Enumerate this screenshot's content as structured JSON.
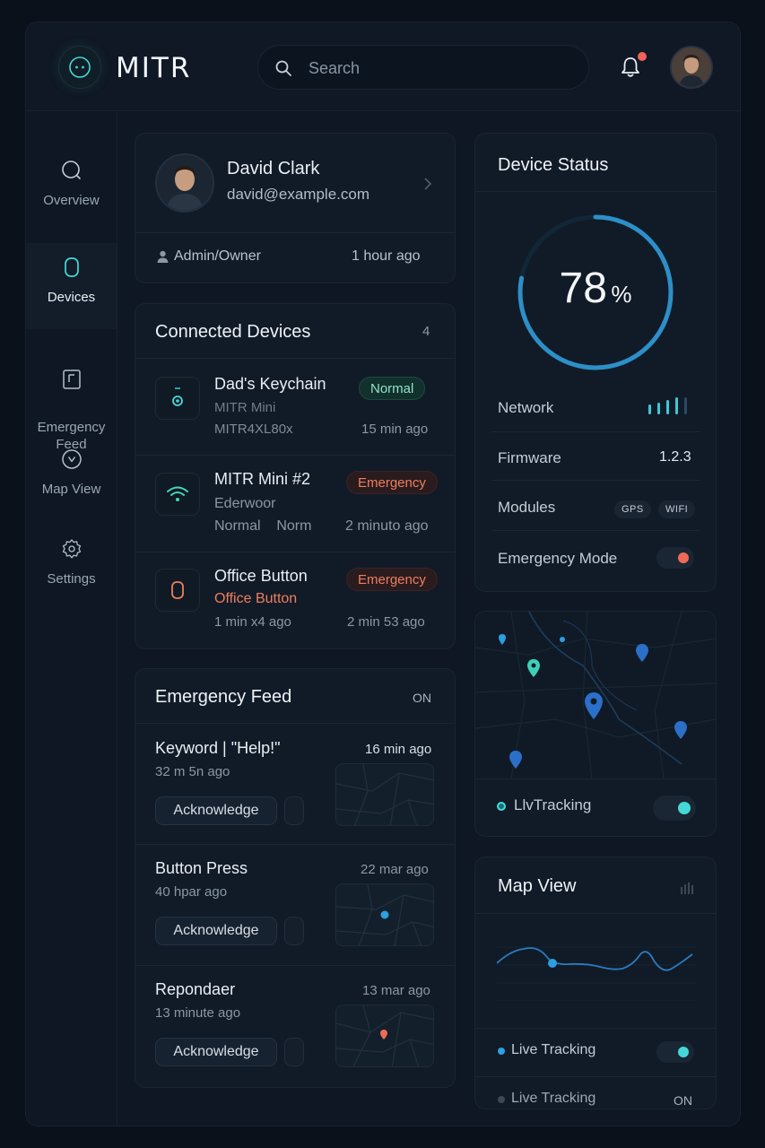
{
  "app": {
    "name": "MITR"
  },
  "search": {
    "placeholder": "Search"
  },
  "nav": [
    {
      "label": "Overview"
    },
    {
      "label": "Devices"
    },
    {
      "label": "Emergency\nFeed"
    },
    {
      "label": "Map View"
    },
    {
      "label": "Settings"
    }
  ],
  "profile": {
    "name": "David Clark",
    "email": "david@example.com",
    "role": "Admin/Owner",
    "last_seen": "1 hour ago"
  },
  "connected": {
    "title": "Connected Devices",
    "count": "4",
    "devices": [
      {
        "name": "Dad's Keychain",
        "model": "MITR Mini",
        "serial": "MITR4XL80x",
        "status": "Normal",
        "time": "15 min ago"
      },
      {
        "name": "MITR Mini #2",
        "model": "Ederwoor",
        "serial": "Normal    Norm",
        "status": "Emergency",
        "time": "2 minuto ago"
      },
      {
        "name": "Office Button",
        "model": "Office Button",
        "serial": "1 min x4 ago",
        "status": "Emergency",
        "time": "2 min 53 ago"
      }
    ]
  },
  "feed": {
    "title": "Emergency Feed",
    "state": "ON",
    "items": [
      {
        "title": "Keyword | \"Help!\"",
        "time": "16 min ago",
        "sub": "32 m 5n ago",
        "action": "Acknowledge"
      },
      {
        "title": "Button Press",
        "time": "22 mar ago",
        "sub": "40 hpar ago",
        "action": "Acknowledge"
      },
      {
        "title": "Repondaer",
        "time": "13 mar ago",
        "sub": "13 minute ago",
        "action": "Acknowledge"
      }
    ]
  },
  "status": {
    "title": "Device Status",
    "battery_value": "78",
    "battery_unit": "%",
    "battery_fraction": 0.78,
    "rows": {
      "network": "Network",
      "firmware_label": "Firmware",
      "firmware_value": "1.2.3",
      "modules_label": "Modules",
      "module_gps": "GPS",
      "module_wifi": "WIFI",
      "emergency_mode": "Emergency Mode"
    }
  },
  "tracking": {
    "label": "LlvTracking"
  },
  "mapview": {
    "title": "Map View",
    "live1": "Live Tracking",
    "live2": "Live Tracking",
    "live2_state": "ON"
  },
  "colors": {
    "accent": "#45d8d8",
    "blue": "#2d8fc8",
    "danger": "#ef6b55",
    "normal": "#8ce3c8"
  }
}
